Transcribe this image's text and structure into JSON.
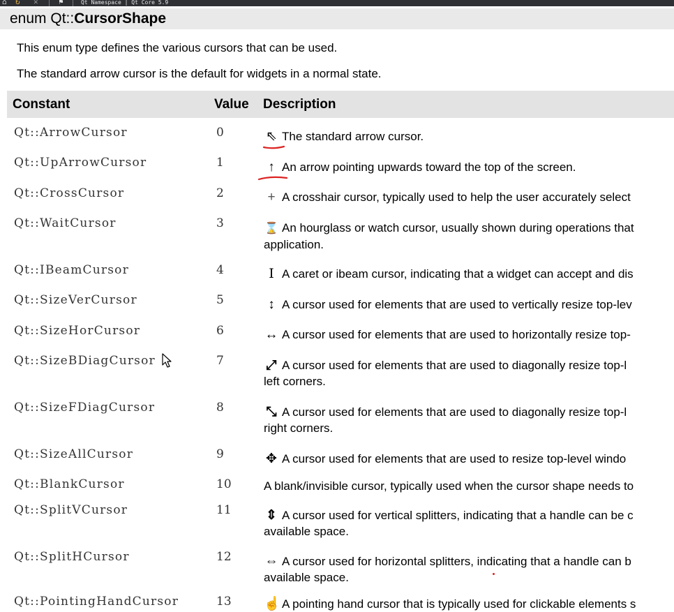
{
  "window": {
    "title": "Qt Namespace | Qt Core 5.9"
  },
  "section": {
    "heading_prefix": "enum Qt::",
    "heading_name": "CursorShape",
    "intro": [
      "This enum type defines the various cursors that can be used.",
      "The standard arrow cursor is the default for widgets in a normal state."
    ]
  },
  "table": {
    "headers": [
      "Constant",
      "Value",
      "Description"
    ],
    "rows": [
      {
        "constant": "Qt::ArrowCursor",
        "value": "0",
        "icon": "arrow-cursor-icon",
        "glyph": "⇖",
        "desc": "The standard arrow cursor.",
        "desc2": ""
      },
      {
        "constant": "Qt::UpArrowCursor",
        "value": "1",
        "icon": "up-arrow-cursor-icon",
        "glyph": "↑",
        "desc": "An arrow pointing upwards toward the top of the screen.",
        "desc2": ""
      },
      {
        "constant": "Qt::CrossCursor",
        "value": "2",
        "icon": "cross-cursor-icon",
        "glyph": "+",
        "desc": "A crosshair cursor, typically used to help the user accurately select",
        "desc2": ""
      },
      {
        "constant": "Qt::WaitCursor",
        "value": "3",
        "icon": "hourglass-cursor-icon",
        "glyph": "⌛",
        "desc": "An hourglass or watch cursor, usually shown during operations that",
        "desc2": "application."
      },
      {
        "constant": "Qt::IBeamCursor",
        "value": "4",
        "icon": "ibeam-cursor-icon",
        "glyph": "I",
        "desc": "A caret or ibeam cursor, indicating that a widget can accept and dis",
        "desc2": ""
      },
      {
        "constant": "Qt::SizeVerCursor",
        "value": "5",
        "icon": "size-ver-cursor-icon",
        "glyph": "↕",
        "desc": "A cursor used for elements that are used to vertically resize top-lev",
        "desc2": ""
      },
      {
        "constant": "Qt::SizeHorCursor",
        "value": "6",
        "icon": "size-hor-cursor-icon",
        "glyph": "↔",
        "desc": "A cursor used for elements that are used to horizontally resize top-",
        "desc2": ""
      },
      {
        "constant": "Qt::SizeBDiagCursor",
        "value": "7",
        "icon": "size-bdiag-cursor-icon",
        "glyph": "⤢",
        "desc": "A cursor used for elements that are used to diagonally resize top-l",
        "desc2": "left corners."
      },
      {
        "constant": "Qt::SizeFDiagCursor",
        "value": "8",
        "icon": "size-fdiag-cursor-icon",
        "glyph": "⤡",
        "desc": "A cursor used for elements that are used to diagonally resize top-l",
        "desc2": "right corners."
      },
      {
        "constant": "Qt::SizeAllCursor",
        "value": "9",
        "icon": "size-all-cursor-icon",
        "glyph": "✥",
        "desc": "A cursor used for elements that are used to resize top-level windo",
        "desc2": ""
      },
      {
        "constant": "Qt::BlankCursor",
        "value": "10",
        "icon": "",
        "glyph": "",
        "desc": "A blank/invisible cursor, typically used when the cursor shape needs to",
        "desc2": ""
      },
      {
        "constant": "Qt::SplitVCursor",
        "value": "11",
        "icon": "split-v-cursor-icon",
        "glyph": "⇕",
        "desc": "A cursor used for vertical splitters, indicating that a handle can be c",
        "desc2": "available space."
      },
      {
        "constant": "Qt::SplitHCursor",
        "value": "12",
        "icon": "split-h-cursor-icon",
        "glyph": "⇔",
        "desc": "A cursor used for horizontal splitters, indicating that a handle can b",
        "desc2": "available space."
      },
      {
        "constant": "Qt::PointingHandCursor",
        "value": "13",
        "icon": "pointing-hand-cursor-icon",
        "glyph": "☝",
        "desc": "A pointing hand cursor that is typically used for clickable elements s",
        "desc2": ""
      }
    ]
  },
  "colors": {
    "heading_bg": "#e9e9e9",
    "table_header_bg": "#e3e3e3",
    "annotation_red": "#dd2222",
    "titlebar_bg": "#2d2f33"
  }
}
